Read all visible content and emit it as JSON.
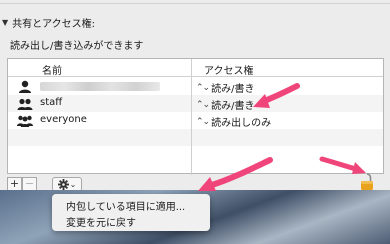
{
  "section": {
    "disclosure_glyph": "▼",
    "title": "共有とアクセス権:",
    "access_summary": "読み出し/書き込みができます"
  },
  "table": {
    "columns": [
      "名前",
      "アクセス権"
    ],
    "rows": [
      {
        "name": "",
        "name_blurred": true,
        "icon": "single-user-icon",
        "access": "読み/書き"
      },
      {
        "name": "staff",
        "icon": "group-icon",
        "access": "読み/書き"
      },
      {
        "name": "everyone",
        "icon": "everyone-icon",
        "access": "読み出しのみ"
      }
    ],
    "stepper_glyph": "⌃⌄"
  },
  "toolbar": {
    "add_label": "+",
    "remove_label": "−",
    "action_icon": "gear-icon",
    "action_chevron": "⌄",
    "lock_icon": "lock-open-icon"
  },
  "menu": {
    "items": [
      "内包している項目に適用...",
      "変更を元に戻す"
    ]
  },
  "colors": {
    "annotation_arrow": "#f0457a",
    "lock": "#e8a21d"
  }
}
